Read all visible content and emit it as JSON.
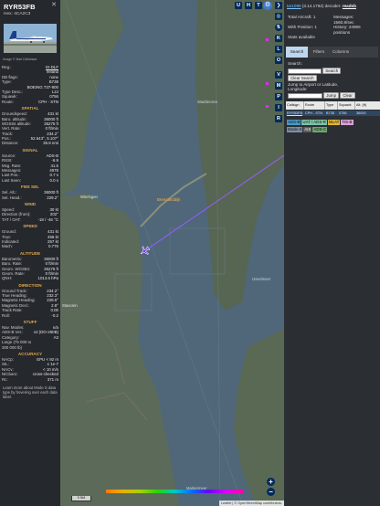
{
  "aircraft": {
    "callsign": "RYR53FB",
    "hex_line": "Hex: 4CA2C3",
    "image_credit": "Image © Bart Dibbelaar",
    "close_icon": "close-icon"
  },
  "left_rows": {
    "reg": {
      "k": "Reg.:",
      "v": "EI-DLF"
    },
    "country": {
      "k": "",
      "v": "Ireland"
    },
    "dbflags": {
      "k": "DB flags:",
      "v": "none"
    },
    "type": {
      "k": "Type:",
      "v": "B738"
    },
    "typename": {
      "k": "",
      "v": "BOEING 737-800"
    },
    "typedesc": {
      "k": "Type Desc.:",
      "v": "L2J"
    },
    "squawk": {
      "k": "Squawk:",
      "v": "0756"
    },
    "route": {
      "k": "Route:",
      "v": "CPH - STN"
    }
  },
  "sections": {
    "spatial": "SPATIAL",
    "signal": "SIGNAL",
    "fms": "FMS SEL",
    "wind": "WIND",
    "speed": "SPEED",
    "altitude": "ALTITUDE",
    "direction": "DIRECTION",
    "stuff": "STUFF",
    "accuracy": "ACCURACY"
  },
  "spatial": [
    {
      "k": "Groundspeed:",
      "v": "431 kt"
    },
    {
      "k": "Baro. altitude:",
      "v": "36000 ft"
    },
    {
      "k": "WGS84 altitude:",
      "v": "35275 ft"
    },
    {
      "k": "Vert. Rate:",
      "v": "0 ft/min"
    },
    {
      "k": "Track:",
      "v": "234.2°"
    },
    {
      "k": "Pos.:",
      "v": "52.643°, 5.107°"
    },
    {
      "k": "Distance:",
      "v": "35.8 nmi"
    }
  ],
  "signal": [
    {
      "k": "Source:",
      "v": "ADS-B"
    },
    {
      "k": "RSSI:",
      "v": "-6.9"
    },
    {
      "k": "Msg. Rate:",
      "v": "41.5"
    },
    {
      "k": "Messages:",
      "v": "4978"
    },
    {
      "k": "Last Pos.:",
      "v": "0.7 s"
    },
    {
      "k": "Last Seen:",
      "v": "0.0 s"
    }
  ],
  "fms": [
    {
      "k": "Sel. Alt.:",
      "v": "36000 ft"
    },
    {
      "k": "Sel. Head.:",
      "v": "229.2°"
    }
  ],
  "wind": [
    {
      "k": "Speed:",
      "v": "30 kt"
    },
    {
      "k": "Direction (from):",
      "v": "202°"
    },
    {
      "k": "TAT / OAT:",
      "v": "-18 / -46 °C"
    }
  ],
  "speed": [
    {
      "k": "Ground:",
      "v": "431 kt"
    },
    {
      "k": "True:",
      "v": "456 kt"
    },
    {
      "k": "Indicated:",
      "v": "257 kt"
    },
    {
      "k": "Mach:",
      "v": "0.776"
    }
  ],
  "altitude": [
    {
      "k": "Barometric:",
      "v": "36000 ft"
    },
    {
      "k": "Baro. Rate:",
      "v": "0 ft/min"
    },
    {
      "k": "Geom. WGS84:",
      "v": "35275 ft"
    },
    {
      "k": "Geom. Rate:",
      "v": "0 ft/min"
    },
    {
      "k": "QNH:",
      "v": "1013.6 hPa"
    }
  ],
  "direction": [
    {
      "k": "Ground Track:",
      "v": "234.2°"
    },
    {
      "k": "True Heading:",
      "v": "232.3°"
    },
    {
      "k": "Magnetic Heading:",
      "v": "229.6°"
    },
    {
      "k": "Magnetic Decl.:",
      "v": "2.8°"
    },
    {
      "k": "Track Rate:",
      "v": "0.00"
    },
    {
      "k": "Roll:",
      "v": "-0.2"
    }
  ],
  "stuff": [
    {
      "k": "Nav. Modes:",
      "v": "n/a"
    },
    {
      "k": "ADS-B Ver.:",
      "v": "v2 (DO-260B)"
    },
    {
      "k": "Category:",
      "v": "A3"
    },
    {
      "k": "Large (75 000 to",
      "v": ""
    },
    {
      "k": "300 000 lb)",
      "v": ""
    }
  ],
  "accuracy": [
    {
      "k": "NACp:",
      "v": "EPU < 92 m"
    },
    {
      "k": "SIL:",
      "v": "≤ 1e-7"
    },
    {
      "k": "NACv:",
      "v": "< 10 m/s"
    },
    {
      "k": "NICbaro:",
      "v": "cross-checked"
    },
    {
      "k": "Rc:",
      "v": "371 m"
    }
  ],
  "left_footer": "Learn more about Mode S data type by hovering over each data label.",
  "map": {
    "labels": {
      "town1": "Wieringen",
      "town2": "Breezanddijk",
      "water1": "Waddenzee",
      "water2": "IJsselmeer",
      "water3": "Markermeer",
      "town3": "Stavoren"
    },
    "top_buttons": [
      "U",
      "H",
      "T"
    ],
    "side_buttons": [
      "K",
      "L",
      "O",
      "V",
      "M",
      "P",
      "I",
      "R"
    ],
    "scale": "5 NM",
    "attribution": "Leaflet | © OpenStreetMap contributors.",
    "attribution_link": "OpenStreetMap",
    "zoom_in": "+",
    "zoom_out": "−",
    "track_color": "#9b5cff",
    "aircraft_color": "#7a3cff",
    "water_color": "#4f6779",
    "land_color": "#5c6b59"
  },
  "right": {
    "top": {
      "prefix": "",
      "link": "tar1090",
      "version": "(3.14.1792)",
      "decoder": "decoder:",
      "decoder_link": "readsb"
    },
    "stats": [
      {
        "a": "Total Aircraft: 1",
        "b": "Messages:"
      },
      {
        "a": "",
        "b": "1560.8/sec"
      },
      {
        "a": "With Position: 1",
        "b": "History: 24966"
      },
      {
        "a": "",
        "b": "positions"
      },
      {
        "a": "Stats available",
        "b": ""
      }
    ],
    "tabs": [
      "Search",
      "Filters",
      "Columns"
    ],
    "search_label": "Search:",
    "search_button": "Search",
    "clear_search": "Clear Search",
    "jump_label": "Jump to Airport or Latitude, Longitude:",
    "jump_button": "Jump",
    "clear_button": "Clear",
    "table_headers": [
      "Callsign",
      "Route",
      "Type",
      "Squawk",
      "Alt. (ft)"
    ],
    "table_row": [
      "RYR53FB",
      "CPH - STN",
      "B738",
      "0756",
      "36000"
    ],
    "legend": [
      {
        "label": "ADS-B",
        "bg": "#4a9ac6"
      },
      {
        "label": "UAT / ADS-R",
        "bg": "#7ec2a8"
      },
      {
        "label": "MLAT",
        "bg": "#e0b33a"
      },
      {
        "label": "TIS-B",
        "bg": "#d9a3d8"
      },
      {
        "label": "Mode-S",
        "bg": "#7f8fa3"
      },
      {
        "label": "AIS",
        "bg": "#5f5f5f"
      },
      {
        "label": "ADS-C",
        "bg": "#6ea86b"
      }
    ]
  }
}
